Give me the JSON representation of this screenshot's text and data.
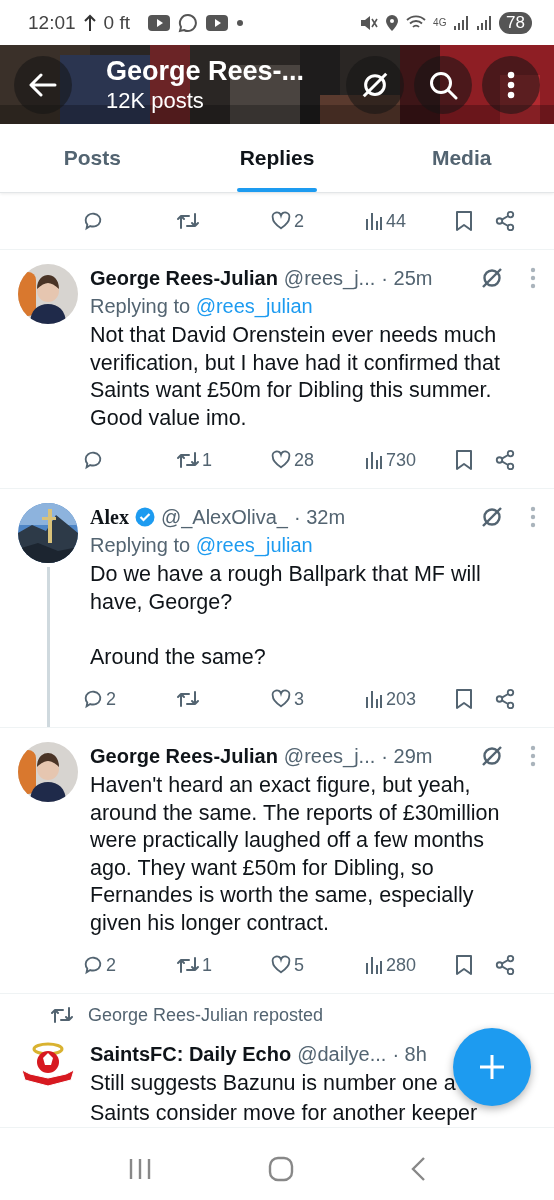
{
  "status_bar": {
    "time": "12:01",
    "distance": "0 ft",
    "network": "4G",
    "battery": "78"
  },
  "header": {
    "title": "George Rees-...",
    "subtitle": "12K posts"
  },
  "tabs": [
    {
      "label": "Posts",
      "selected": false
    },
    {
      "label": "Replies",
      "selected": true
    },
    {
      "label": "Media",
      "selected": false
    }
  ],
  "posts": [
    {
      "kind": "actions_only",
      "actions": {
        "likes": "2",
        "views": "44"
      }
    },
    {
      "kind": "reply",
      "author": "George Rees-Julian",
      "verified": false,
      "handle": "@rees_j...",
      "time": "· 25m",
      "replying_label": "Replying to",
      "replying_to": "@rees_julian",
      "text": "Not that David Orenstein ever needs much verification, but I have had it confirmed that Saints want £50m for Dibling this summer. Good value imo.",
      "thread_line": false,
      "actions": {
        "reposts": "1",
        "likes": "28",
        "views": "730"
      }
    },
    {
      "kind": "reply",
      "author": "Alex",
      "verified": true,
      "handle": "@_AlexOliva_",
      "time": "· 32m",
      "replying_label": "Replying to",
      "replying_to": "@rees_julian",
      "text": "Do we have a rough Ballpark that MF will have, George?\n\nAround the same?",
      "thread_line": true,
      "actions": {
        "replies": "2",
        "likes": "3",
        "views": "203"
      }
    },
    {
      "kind": "reply",
      "author": "George Rees-Julian",
      "verified": false,
      "handle": "@rees_j...",
      "time": "· 29m",
      "text": "Haven't heard an exact figure, but yeah, around the same. The reports of £30million were practically laughed off a few months ago. They want £50m for Dibling, so Fernandes is worth the same, especially given his longer contract.",
      "thread_line": false,
      "actions": {
        "replies": "2",
        "reposts": "1",
        "likes": "5",
        "views": "280"
      }
    },
    {
      "kind": "repost",
      "reposted_by": "George Rees-Julian reposted",
      "author": "SaintsFC: Daily Echo",
      "verified": false,
      "handle": "@dailye...",
      "time": "· 8h",
      "lines": [
        "Still suggests Bazunu is number one a",
        "Saints consider move for another keeper"
      ],
      "thread_line": false
    }
  ]
}
